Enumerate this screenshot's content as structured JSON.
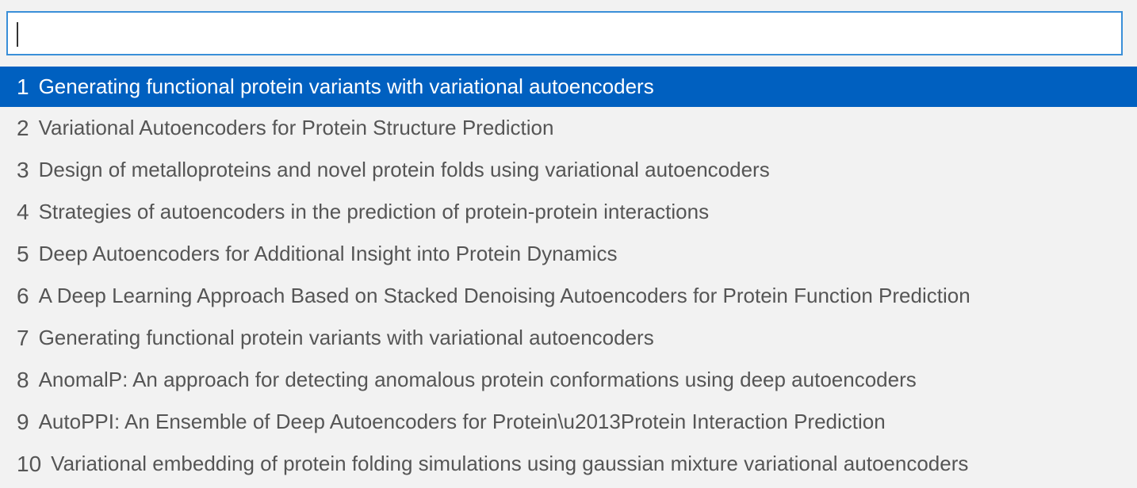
{
  "search": {
    "value": "",
    "placeholder": ""
  },
  "colors": {
    "background": "#f2f2f2",
    "selected_background": "#0060c0",
    "input_border": "#3a8fd8",
    "text": "#555555"
  },
  "results": [
    {
      "num": "1",
      "title": "Generating functional protein variants with variational autoencoders",
      "selected": true
    },
    {
      "num": "2",
      "title": "Variational Autoencoders for Protein Structure Prediction",
      "selected": false
    },
    {
      "num": "3",
      "title": "Design of metalloproteins and novel protein folds using variational autoencoders",
      "selected": false
    },
    {
      "num": "4",
      "title": "Strategies of autoencoders in the prediction of protein-protein interactions",
      "selected": false
    },
    {
      "num": "5",
      "title": "Deep Autoencoders for Additional Insight into Protein Dynamics",
      "selected": false
    },
    {
      "num": "6",
      "title": "A Deep Learning Approach Based on Stacked Denoising Autoencoders for Protein Function Prediction",
      "selected": false
    },
    {
      "num": "7",
      "title": "Generating functional protein variants with variational autoencoders",
      "selected": false
    },
    {
      "num": "8",
      "title": "AnomalP: An approach for detecting anomalous protein conformations using deep autoencoders",
      "selected": false
    },
    {
      "num": "9",
      "title": "AutoPPI: An Ensemble of Deep Autoencoders for Protein\\u2013Protein Interaction Prediction",
      "selected": false
    },
    {
      "num": "10",
      "title": "Variational embedding of protein folding simulations using gaussian mixture variational autoencoders",
      "selected": false
    }
  ]
}
